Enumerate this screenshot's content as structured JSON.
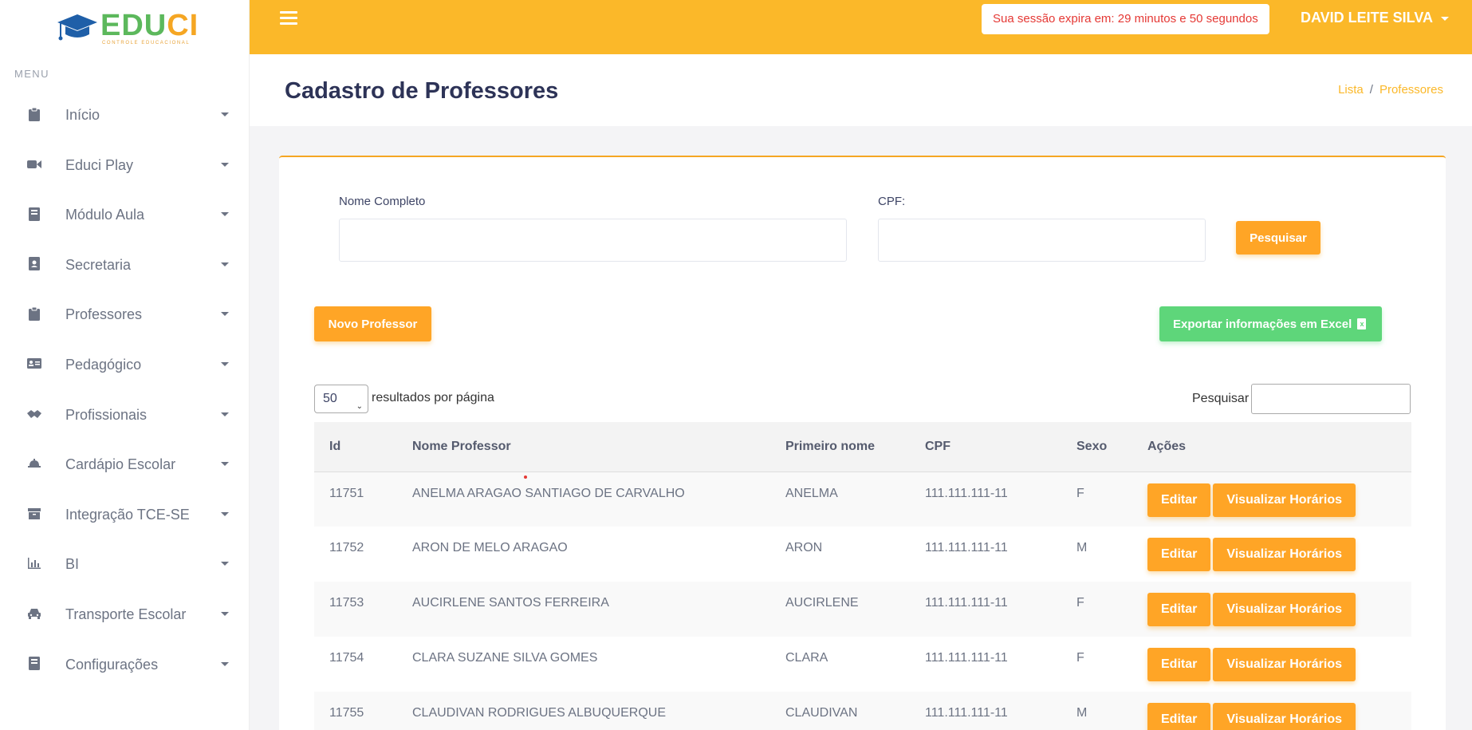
{
  "brand": {
    "name_part1": "EDU",
    "name_part2": "CI",
    "tagline": "CONTROLE EDUCACIONAL",
    "color_part1": "#5cb85c",
    "color_part2": "#f5a623",
    "hat_color": "#1f5fa8"
  },
  "sidebar": {
    "menu_title": "MENU",
    "items": [
      {
        "label": "Início",
        "icon": "clipboard-icon"
      },
      {
        "label": "Educi Play",
        "icon": "video-camera-icon"
      },
      {
        "label": "Módulo Aula",
        "icon": "book-icon"
      },
      {
        "label": "Secretaria",
        "icon": "address-book-icon"
      },
      {
        "label": "Professores",
        "icon": "clipboard-icon"
      },
      {
        "label": "Pedagógico",
        "icon": "id-card-icon"
      },
      {
        "label": "Profissionais",
        "icon": "handshake-icon"
      },
      {
        "label": "Cardápio Escolar",
        "icon": "cloche-icon"
      },
      {
        "label": "Integração TCE-SE",
        "icon": "archive-icon"
      },
      {
        "label": "BI",
        "icon": "bar-chart-icon"
      },
      {
        "label": "Transporte Escolar",
        "icon": "car-icon"
      },
      {
        "label": "Configurações",
        "icon": "book-icon"
      }
    ]
  },
  "topbar": {
    "session_text": "Sua sessão expira em: 29 minutos e 50 segundos",
    "user_name": "DAVID LEITE SILVA",
    "bg_color": "#fbb829"
  },
  "page": {
    "title": "Cadastro de Professores",
    "breadcrumb": [
      "Lista",
      "Professores"
    ]
  },
  "filters": {
    "name_label": "Nome Completo",
    "name_value": "",
    "cpf_label": "CPF:",
    "cpf_value": "",
    "search_button": "Pesquisar"
  },
  "actions": {
    "new_button": "Novo Professor",
    "export_button": "Exportar informações em Excel"
  },
  "datatable": {
    "page_length": "50",
    "length_label": "resultados por página",
    "search_label": "Pesquisar",
    "columns": [
      "Id",
      "Nome Professor",
      "Primeiro nome",
      "CPF",
      "Sexo",
      "Ações"
    ],
    "rows": [
      {
        "id": "11751",
        "name": "ANELMA ARAGAO SANTIAGO DE CARVALHO",
        "first": "ANELMA",
        "cpf": "111.111.111-11",
        "sex": "F"
      },
      {
        "id": "11752",
        "name": "ARON DE MELO ARAGAO",
        "first": "ARON",
        "cpf": "111.111.111-11",
        "sex": "M"
      },
      {
        "id": "11753",
        "name": "AUCIRLENE SANTOS FERREIRA",
        "first": "AUCIRLENE",
        "cpf": "111.111.111-11",
        "sex": "F"
      },
      {
        "id": "11754",
        "name": "CLARA SUZANE SILVA GOMES",
        "first": "CLARA",
        "cpf": "111.111.111-11",
        "sex": "F"
      },
      {
        "id": "11755",
        "name": "CLAUDIVAN RODRIGUES ALBUQUERQUE",
        "first": "CLAUDIVAN",
        "cpf": "111.111.111-11",
        "sex": "M"
      }
    ],
    "edit_label": "Editar",
    "schedule_label": "Visualizar Horários"
  }
}
